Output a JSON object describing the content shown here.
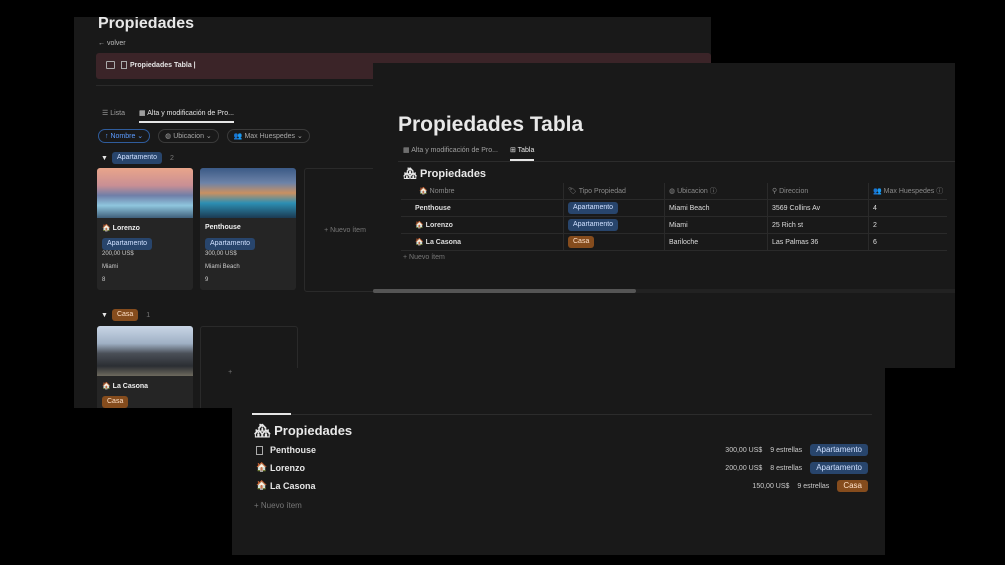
{
  "panel_gallery": {
    "title": "Propiedades",
    "back_link": "← volver",
    "linked_db_label": "Propiedades Tabla |",
    "tabs": [
      {
        "label": "Lista"
      },
      {
        "label": "Alta y modificación de Pro..."
      }
    ],
    "filters": [
      {
        "label": "↑ Nombre ⌄"
      },
      {
        "label": "Ubicacion ⌄"
      },
      {
        "label": "Max Huespedes ⌄"
      }
    ],
    "groups": [
      {
        "label": "Apartamento",
        "count": "2",
        "cards": [
          {
            "name": "Lorenzo",
            "type": "Apartamento",
            "price": "200,00 US$",
            "location": "Miami",
            "guests": "8"
          },
          {
            "name": "Penthouse",
            "type": "Apartamento",
            "price": "300,00 US$",
            "location": "Miami Beach",
            "guests": "9"
          }
        ],
        "new_item": "+ Nuevo ítem"
      },
      {
        "label": "Casa",
        "count": "1",
        "cards": [
          {
            "name": "La Casona",
            "type": "Casa"
          }
        ],
        "new_item": "+ Nuevo ítem"
      }
    ]
  },
  "panel_table": {
    "title": "Propiedades Tabla",
    "tabs": [
      {
        "label": "Alta y modificación de Pro..."
      },
      {
        "label": "Tabla"
      }
    ],
    "db_title": "Propiedades",
    "columns": [
      "Nombre",
      "Tipo Propiedad",
      "Ubicacion",
      "Direccion",
      "Max Huespedes"
    ],
    "rows": [
      {
        "name": "Penthouse",
        "type": "Apartamento",
        "location": "Miami Beach",
        "address": "3569 Collins Av",
        "guests": "4"
      },
      {
        "name": "Lorenzo",
        "type": "Apartamento",
        "location": "Miami",
        "address": "25 Rich st",
        "guests": "2"
      },
      {
        "name": "La Casona",
        "type": "Casa",
        "location": "Bariloche",
        "address": "Las Palmas 36",
        "guests": "6"
      }
    ],
    "new_item": "+ Nuevo ítem"
  },
  "panel_list": {
    "db_title": "Propiedades",
    "items": [
      {
        "name": "Penthouse",
        "price": "300,00 US$",
        "stars": "9 estrellas",
        "type": "Apartamento"
      },
      {
        "name": "Lorenzo",
        "price": "200,00 US$",
        "stars": "8 estrellas",
        "type": "Apartamento"
      },
      {
        "name": "La Casona",
        "price": "150,00 US$",
        "stars": "9 estrellas",
        "type": "Casa"
      }
    ],
    "new_item": "+ Nuevo ítem"
  },
  "colors": {
    "apartamento": "#28456c",
    "casa": "#854c1d",
    "bar": "#3b2428"
  }
}
